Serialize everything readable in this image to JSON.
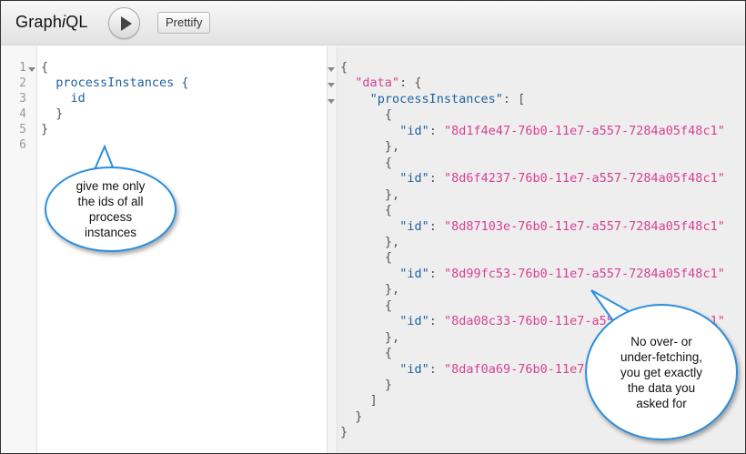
{
  "app": {
    "title_prefix": "Graph",
    "title_italic": "i",
    "title_suffix": "QL"
  },
  "toolbar": {
    "run_icon": "play-icon",
    "prettify_label": "Prettify"
  },
  "query": {
    "line_numbers": [
      "1",
      "2",
      "3",
      "4",
      "5",
      "6"
    ],
    "lines": [
      "{",
      "  processInstances {",
      "    id",
      "  }",
      "}",
      ""
    ]
  },
  "result": {
    "open_brace": "{",
    "data_key": "\"data\"",
    "process_key": "\"processInstances\"",
    "id_key": "\"id\"",
    "ids": [
      "\"8d1f4e47-76b0-11e7-a557-7284a05f48c1\"",
      "\"8d6f4237-76b0-11e7-a557-7284a05f48c1\"",
      "\"8d87103e-76b0-11e7-a557-7284a05f48c1\"",
      "\"8d99fc53-76b0-11e7-a557-7284a05f48c1\"",
      "\"8da08c33-76b0-11e7-a557-7284a05f48c1\"",
      "\"8daf0a69-76b0-11e7-a557-7284a05f48c1\""
    ]
  },
  "callouts": {
    "query_note": "give me only the ids of all process instances",
    "result_note": "No over- or under-fetching, you get exactly the data you asked for"
  },
  "colors": {
    "string": "#d64292",
    "keyword": "#1f61a0",
    "callout_border": "#2a8fe0"
  }
}
